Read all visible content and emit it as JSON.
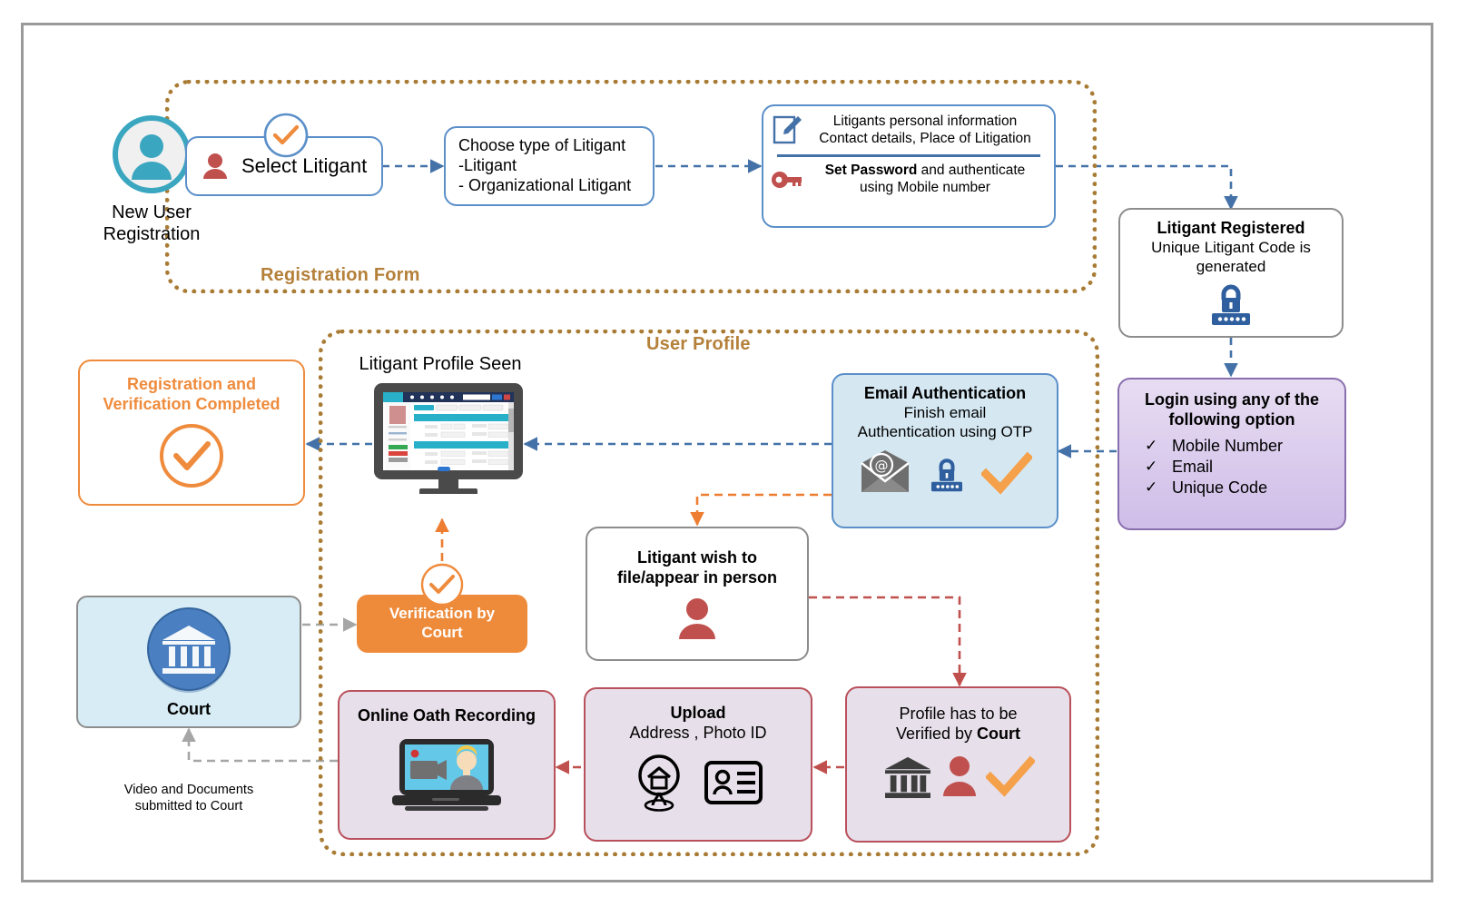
{
  "diagram": {
    "title": "Litigant Registration and Verification Flow",
    "groups": [
      {
        "id": "registration-form",
        "label": "Registration Form"
      },
      {
        "id": "user-profile",
        "label": "User Profile"
      }
    ],
    "nodes": {
      "new_user": {
        "label_line1": "New User",
        "label_line2": "Registration",
        "icon": "user-circle-icon"
      },
      "select_litigant": {
        "label": "Select Litigant",
        "icon": "person-icon",
        "badge_icon": "check-circle-icon"
      },
      "choose_type": {
        "line1": "Choose type of Litigant",
        "line2": " -Litigant",
        "line3": "- Organizational Litigant"
      },
      "personal_info": {
        "top_line1": "Litigants personal information",
        "top_line2": "Contact details, Place of Litigation",
        "bottom_bold": "Set Password",
        "bottom_rest": " and authenticate",
        "bottom_line2": "using Mobile number",
        "top_icon": "document-edit-icon",
        "bottom_icon": "key-icon"
      },
      "litigant_registered": {
        "title": "Litigant Registered",
        "line1": "Unique Litigant Code is",
        "line2": "generated",
        "icon": "password-lock-icon"
      },
      "login_options": {
        "title_line1": "Login using any of the",
        "title_line2": "following option",
        "options": [
          "Mobile Number",
          "Email",
          "Unique Code"
        ],
        "check_glyph": "✓"
      },
      "email_auth": {
        "title": "Email Authentication",
        "line1": "Finish email",
        "line2": "Authentication using OTP",
        "icons": [
          "email-at-icon",
          "password-lock-icon",
          "orange-check-icon"
        ]
      },
      "profile_seen": {
        "caption": "Litigant Profile Seen",
        "icon": "monitor-profile-icon"
      },
      "registration_completed": {
        "line1": "Registration and",
        "line2": "Verification Completed",
        "icon": "check-circle-icon"
      },
      "verification_by_court": {
        "line1": "Verification by",
        "line2": "Court",
        "badge_icon": "check-circle-icon"
      },
      "court": {
        "label": "Court",
        "icon": "court-building-icon"
      },
      "court_note": {
        "line1": "Video and Documents",
        "line2": "submitted to Court"
      },
      "wish_in_person": {
        "line1": "Litigant wish to",
        "line2": "file/appear in person",
        "icon": "person-icon"
      },
      "profile_verified": {
        "line1": "Profile has to be",
        "line2_pre": "Verified by ",
        "line2_bold": "Court",
        "icons": [
          "court-building-icon",
          "person-icon",
          "orange-check-icon"
        ]
      },
      "upload": {
        "title": "Upload",
        "subtitle": "Address , Photo ID",
        "icons": [
          "location-home-icon",
          "id-card-icon"
        ]
      },
      "oath": {
        "title": "Online Oath Recording",
        "icon": "laptop-video-recording-icon"
      }
    },
    "colors": {
      "blue_arrow": "#4472a8",
      "orange_arrow": "#ed7d31",
      "red_arrow": "#c0504d",
      "grey_arrow": "#a6a6a6",
      "dotted_group": "#a97c35",
      "orange_accent": "#ef8b3c",
      "blue_accent": "#5b8fc9",
      "purple_fill": "#cfbde8",
      "red_fill": "#e7dfe9",
      "court_fill": "#d7ecf4",
      "teal": "#3aa6c0"
    }
  }
}
